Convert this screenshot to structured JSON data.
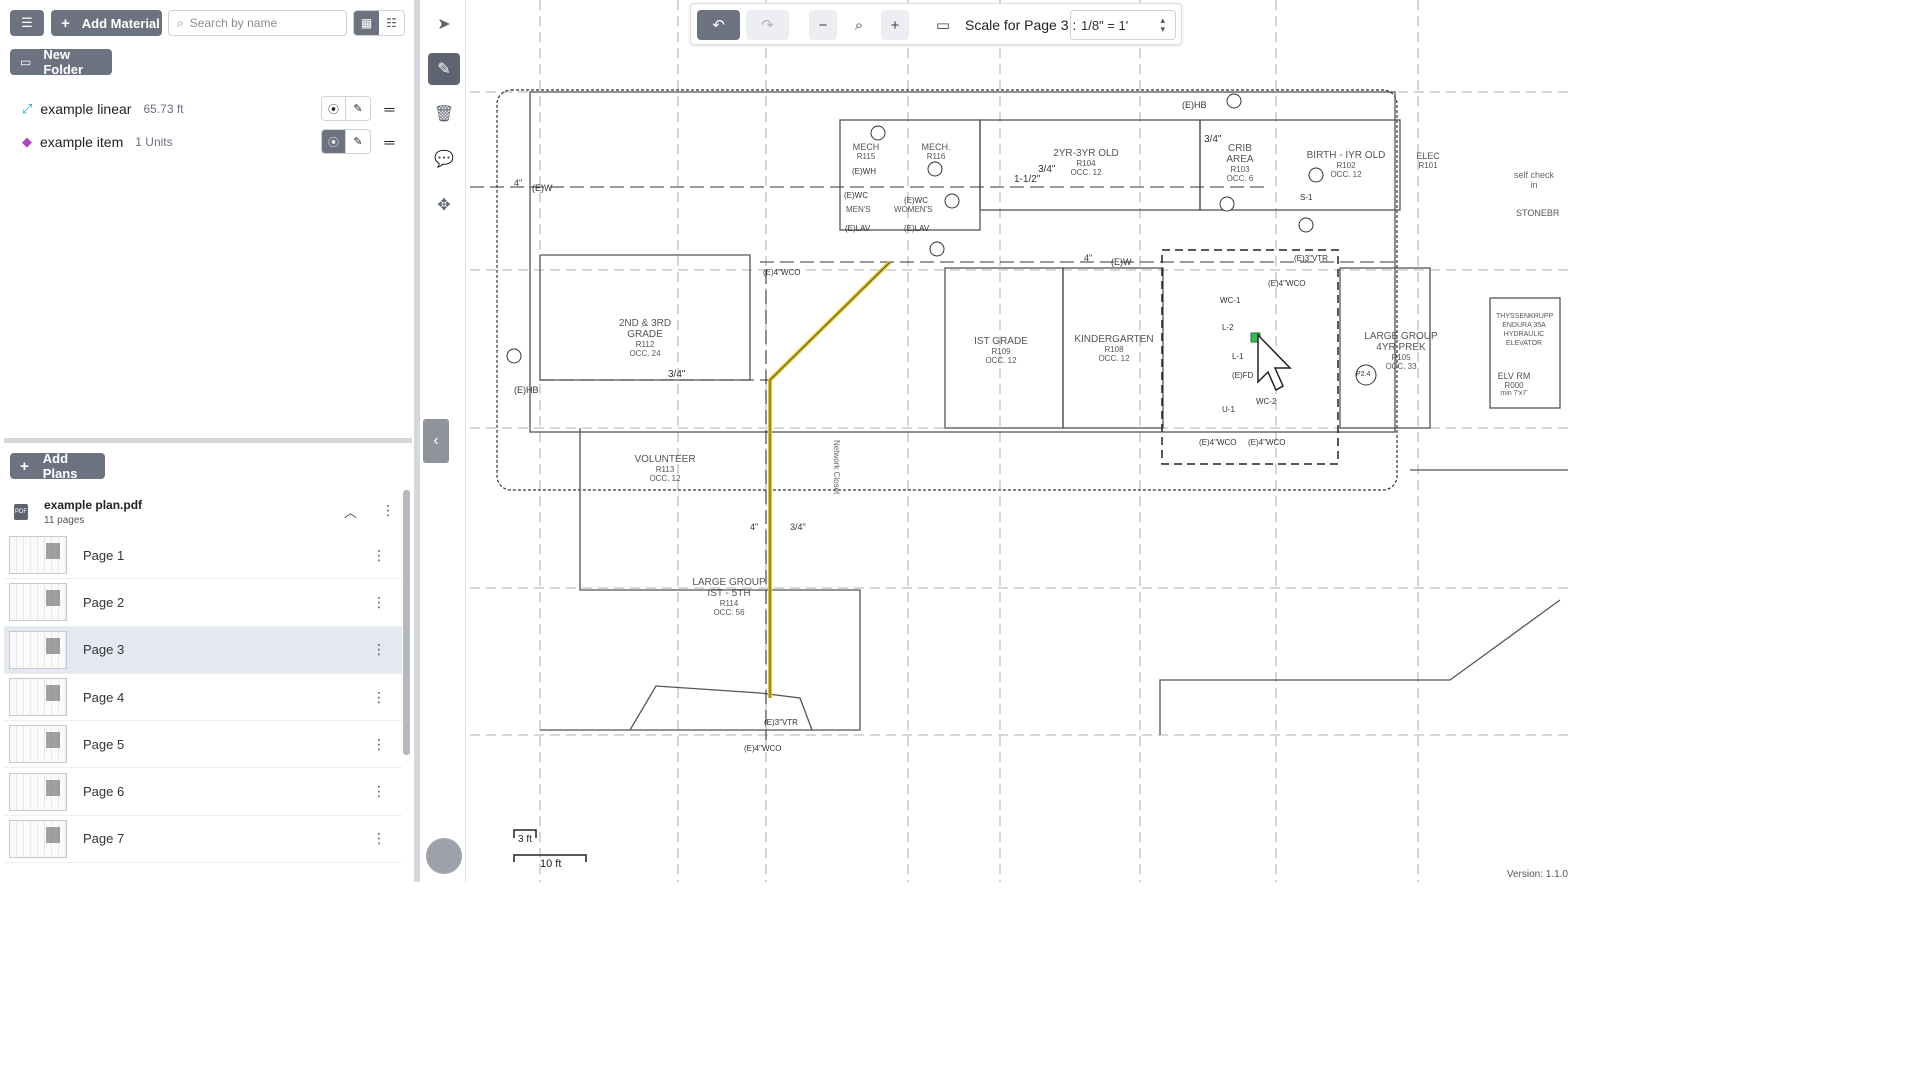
{
  "toolbar_left": {
    "add_material_label": "Add Material",
    "search_placeholder": "Search by name",
    "new_folder_label": "New Folder"
  },
  "materials": [
    {
      "name": "example linear",
      "qty": "65.73 ft",
      "icon": "linear-measure-icon",
      "color": "#2aa7c9"
    },
    {
      "name": "example item",
      "qty": "1 Units",
      "icon": "cube-icon",
      "color": "#b046c7"
    }
  ],
  "plans": {
    "add_plans_label": "Add Plans",
    "file_name": "example plan.pdf",
    "file_pages": "11 pages",
    "pages": [
      {
        "label": "Page 1",
        "selected": false
      },
      {
        "label": "Page 2",
        "selected": false
      },
      {
        "label": "Page 3",
        "selected": true
      },
      {
        "label": "Page 4",
        "selected": false
      },
      {
        "label": "Page 5",
        "selected": false
      },
      {
        "label": "Page 6",
        "selected": false
      },
      {
        "label": "Page 7",
        "selected": false
      }
    ]
  },
  "canvas_toolbar": {
    "scale_label": "Scale for Page 3 :",
    "scale_value": "1/8\" = 1'"
  },
  "drawing": {
    "rooms": [
      {
        "name": "2ND & 3RD GRADE",
        "num": "R112",
        "occ": "OCC. 24"
      },
      {
        "name": "VOLUNTEER",
        "num": "R113",
        "occ": "OCC. 12"
      },
      {
        "name": "LARGE GROUP",
        "name2": "IST - 5TH",
        "num": "R114",
        "occ": "OCC. 56"
      },
      {
        "name": "IST GRADE",
        "num": "R109",
        "occ": "OCC. 12"
      },
      {
        "name": "KINDERGARTEN",
        "num": "R108",
        "occ": "OCC. 12"
      },
      {
        "name": "LARGE GROUP",
        "name2": "4YR PREK",
        "num": "R105",
        "occ": "OCC. 33"
      },
      {
        "name": "2YR-3YR OLD",
        "num": "R104",
        "occ": "OCC. 12"
      },
      {
        "name": "CRIB",
        "name2": "AREA",
        "num": "R103",
        "occ": "OCC. 6"
      },
      {
        "name": "BIRTH - IYR OLD",
        "num": "R102",
        "occ": "OCC. 12"
      },
      {
        "name": "MECH",
        "num": "R115"
      },
      {
        "name": "MECH.",
        "num": "R116"
      },
      {
        "name": "ELEC",
        "num": "R101"
      },
      {
        "name": "ELV RM",
        "num": "R000",
        "occ": "min 7'x7'"
      }
    ],
    "elevator_text": [
      "THYSSENKRUPP",
      "ENDURA 35A",
      "HYDRAULIC",
      "ELEVATOR"
    ],
    "labels": [
      "(E)HB",
      "(E)W",
      "4\"",
      "3/4\"",
      "1-1/2\"",
      "(E)4\"WCO",
      "(E)3\"VTR",
      "(E)WH",
      "(E)WC",
      "(E)LAV",
      "MEN'S",
      "WOMEN'S",
      "S-1",
      "WC-1",
      "WC-2",
      "L-1",
      "L-2",
      "U-1",
      "(E)FD",
      "P2.4",
      "self check in",
      "STONEBR",
      "Network Closet",
      "3 ft",
      "10 ft"
    ]
  },
  "version": "Version: 1.1.0"
}
